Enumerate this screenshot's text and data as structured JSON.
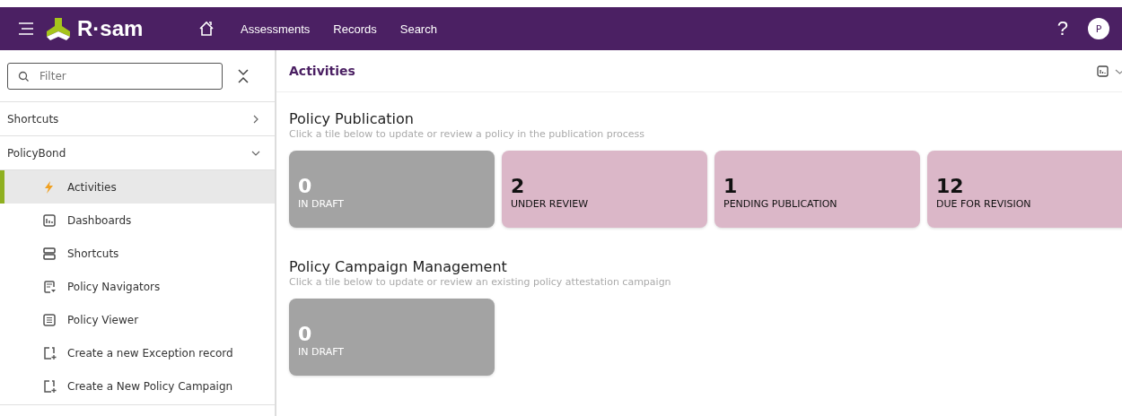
{
  "header": {
    "logo": "R·sam",
    "nav": [
      {
        "label": "Assessments"
      },
      {
        "label": "Records"
      },
      {
        "label": "Search"
      }
    ],
    "help": "?",
    "avatar": "P"
  },
  "sidebar": {
    "filter": {
      "placeholder": "Filter"
    },
    "sections": [
      {
        "label": "Shortcuts",
        "expanded": false
      },
      {
        "label": "PolicyBond",
        "expanded": true,
        "items": [
          {
            "label": "Activities",
            "selected": true
          },
          {
            "label": "Dashboards",
            "selected": false
          },
          {
            "label": "Shortcuts",
            "selected": false
          },
          {
            "label": "Policy Navigators",
            "selected": false
          },
          {
            "label": "Policy Viewer",
            "selected": false
          },
          {
            "label": "Create a new Exception record",
            "selected": false
          },
          {
            "label": "Create a New Policy Campaign",
            "selected": false
          }
        ]
      }
    ]
  },
  "main": {
    "title": "Activities",
    "groups": [
      {
        "title": "Policy Publication",
        "subtitle": "Click a tile below to update or review a policy in the publication process",
        "tiles": [
          {
            "count": "0",
            "label": "IN DRAFT",
            "kind": "empty"
          },
          {
            "count": "2",
            "label": "UNDER REVIEW",
            "kind": "active"
          },
          {
            "count": "1",
            "label": "PENDING PUBLICATION",
            "kind": "active"
          },
          {
            "count": "12",
            "label": "DUE FOR REVISION",
            "kind": "active"
          }
        ]
      },
      {
        "title": "Policy Campaign Management",
        "subtitle": "Click a tile below to update or review an existing policy attestation campaign",
        "tiles": [
          {
            "count": "0",
            "label": "IN DRAFT",
            "kind": "empty"
          }
        ]
      }
    ]
  }
}
